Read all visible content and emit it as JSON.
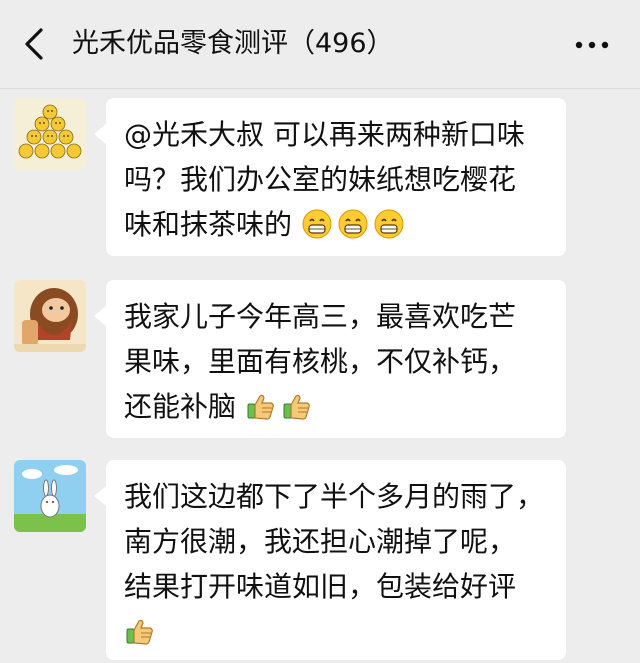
{
  "header": {
    "title": "光禾优品零食测评（496）",
    "back_icon": "chevron-left-icon",
    "more_icon": "more-dots-icon"
  },
  "messages": [
    {
      "avatar_icon": "chick-pile-avatar",
      "lines": [
        "@光禾大叔 可以再来两种新口味",
        "吗？我们办公室的妹纸想吃樱花",
        "味和抹茶味的"
      ],
      "emojis": [
        "grin-emoji",
        "grin-emoji",
        "grin-emoji"
      ]
    },
    {
      "avatar_icon": "cartoon-face-avatar",
      "lines": [
        "我家儿子今年高三，最喜欢吃芒",
        "果味，里面有核桃，不仅补钙，",
        "还能补脑"
      ],
      "emojis": [
        "thumbs-up-emoji",
        "thumbs-up-emoji"
      ]
    },
    {
      "avatar_icon": "rabbit-sky-avatar",
      "lines": [
        "我们这边都下了半个多月的雨了，",
        "南方很潮，我还担心潮掉了呢，",
        "结果打开味道如旧，包装给好评"
      ],
      "emojis": [
        "thumbs-up-emoji"
      ]
    }
  ],
  "colors": {
    "background": "#ededed",
    "bubble": "#ffffff",
    "text": "#111111"
  }
}
